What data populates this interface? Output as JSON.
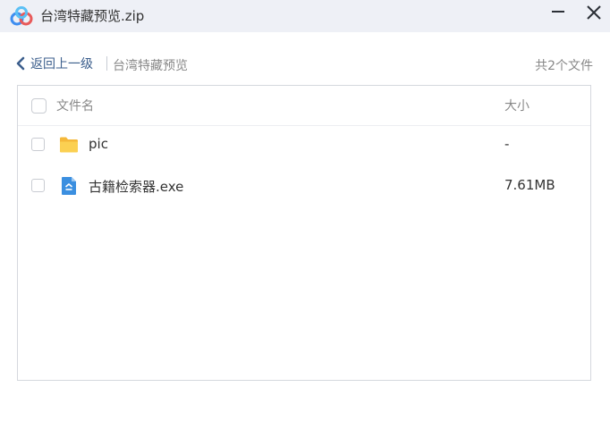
{
  "window": {
    "title": "台湾特藏预览.zip",
    "app_icon": "baidu-netdisk-cloud-icon",
    "controls": [
      "minimize-icon",
      "close-icon"
    ]
  },
  "nav": {
    "back_label": "返回上一级",
    "current_folder": "台湾特藏预览",
    "file_count": "共2个文件"
  },
  "table": {
    "columns": {
      "name": "文件名",
      "size": "大小"
    },
    "rows": [
      {
        "name": "pic",
        "size": "-",
        "icon": "folder-icon"
      },
      {
        "name": "古籍检索器.exe",
        "size": "7.61MB",
        "icon": "exe-file-icon"
      }
    ]
  },
  "colors": {
    "titlebar_bg": "#eef0f6",
    "link_blue": "#3b5e8c",
    "folder_yellow": "#f7c744",
    "exe_blue": "#3b8fe0"
  }
}
